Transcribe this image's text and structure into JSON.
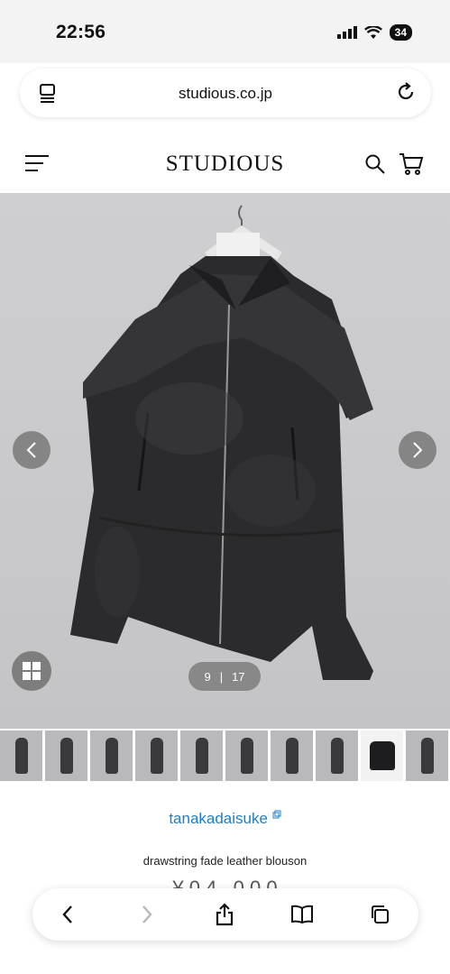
{
  "status_bar": {
    "time": "22:56",
    "battery": "34"
  },
  "browser": {
    "url": "studious.co.jp"
  },
  "site": {
    "logo": "STUDIOUS"
  },
  "gallery": {
    "counter_current": "9",
    "counter_separator": "|",
    "counter_total": "17",
    "thumbnails": 10,
    "active_thumbnail": 9
  },
  "product": {
    "brand": "tanakadaisuke",
    "name": "drawstring fade leather blouson",
    "price": "¥ 0 4 , 0 0 0"
  },
  "colors": {
    "brand_link": "#1d7fc4"
  }
}
